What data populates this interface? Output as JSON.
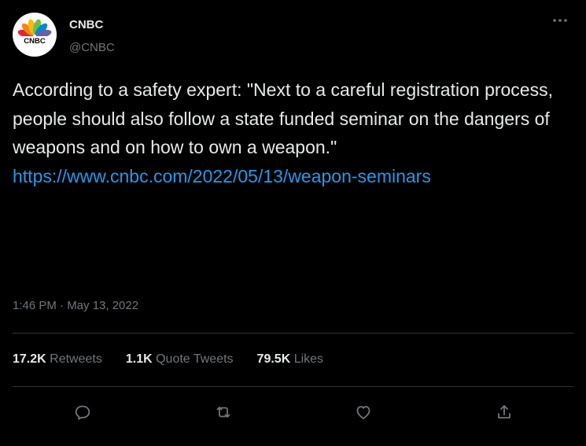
{
  "author": {
    "name": "CNBC",
    "handle": "@CNBC",
    "avatar_text": "CNBC"
  },
  "tweet": {
    "text": "According to a safety expert: \"Next to a careful registration process, people should also follow a state funded seminar on the dangers of weapons and on how to own a weapon.\"",
    "link": "https://www.cnbc.com/2022/05/13/weapon-seminars",
    "timestamp": "1:46 PM · May 13, 2022"
  },
  "stats": {
    "retweets_count": "17.2K",
    "retweets_label": "Retweets",
    "quotes_count": "1.1K",
    "quotes_label": "Quote Tweets",
    "likes_count": "79.5K",
    "likes_label": "Likes"
  },
  "actions": [
    "reply-icon",
    "retweet-icon",
    "like-icon",
    "share-icon"
  ],
  "colors": {
    "background": "#000000",
    "text": "#e7e9ea",
    "muted": "#71767b",
    "link": "#1d9bf0",
    "divider": "#2f3336"
  }
}
